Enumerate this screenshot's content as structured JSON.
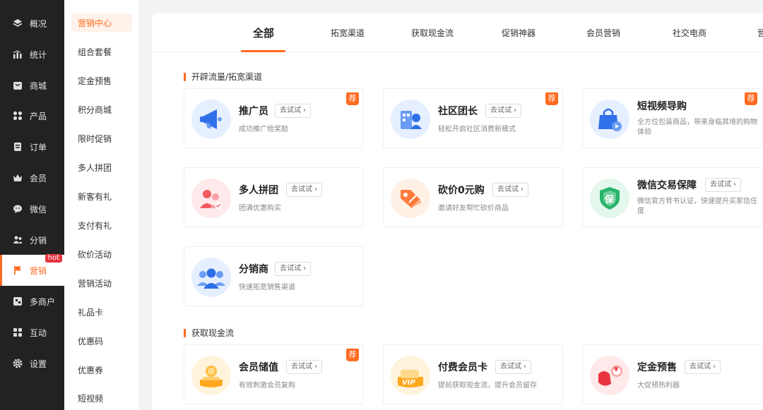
{
  "primary_nav": [
    {
      "label": "概况",
      "icon": "layers-icon"
    },
    {
      "label": "统计",
      "icon": "chart-icon"
    },
    {
      "label": "商城",
      "icon": "store-icon"
    },
    {
      "label": "产品",
      "icon": "grid-icon"
    },
    {
      "label": "订单",
      "icon": "order-icon"
    },
    {
      "label": "会员",
      "icon": "crown-icon"
    },
    {
      "label": "微信",
      "icon": "wechat-icon"
    },
    {
      "label": "分销",
      "icon": "users-icon"
    },
    {
      "label": "营销",
      "icon": "flag-icon",
      "badge": "hot"
    },
    {
      "label": "多商户",
      "icon": "merchant-icon"
    },
    {
      "label": "互动",
      "icon": "interact-icon"
    },
    {
      "label": "设置",
      "icon": "gear-icon"
    }
  ],
  "secondary_nav": [
    "营销中心",
    "组合套餐",
    "定金预售",
    "积分商城",
    "限时促销",
    "多人拼团",
    "新客有礼",
    "支付有礼",
    "砍价活动",
    "营销活动",
    "礼品卡",
    "优惠码",
    "优惠券",
    "短视频"
  ],
  "tabs": [
    "全部",
    "拓宽渠道",
    "获取现金流",
    "促销神器",
    "会员营销",
    "社交电商",
    "营"
  ],
  "try_label": "去试试",
  "badge_label": "荐",
  "sections": [
    {
      "title": "开辟流量/拓宽渠道"
    },
    {
      "title": "获取现金流"
    }
  ],
  "cards": [
    {
      "title": "推广员",
      "desc": "成功推广给奖励",
      "recommended": true,
      "icon": "megaphone-icon"
    },
    {
      "title": "社区团长",
      "desc": "轻松开启社区消费新模式",
      "recommended": true,
      "icon": "community-icon"
    },
    {
      "title": "短视频导购",
      "desc": "全方位包装商品，带来身临其境的购物体验",
      "recommended": true,
      "icon": "video-bag-icon"
    },
    {
      "title": "多人拼团",
      "desc": "团满优惠购买",
      "recommended": false,
      "icon": "group-icon"
    },
    {
      "title": "砍价0元购",
      "desc": "邀请好友帮忙砍价商品",
      "recommended": false,
      "icon": "price-tag-icon"
    },
    {
      "title": "微信交易保障",
      "desc": "微信官方背书认证，快速提升买家信任度",
      "recommended": false,
      "icon": "shield-icon",
      "shield_text": "保"
    },
    {
      "title": "分销商",
      "desc": "快速拓宽销售渠道",
      "recommended": false,
      "icon": "distributor-icon"
    },
    {
      "title": "会员储值",
      "desc": "有效刺激会员复购",
      "recommended": true,
      "icon": "coin-icon"
    },
    {
      "title": "付费会员卡",
      "desc": "提前获取现金流，提升会员留存",
      "recommended": false,
      "icon": "vip-card-icon",
      "card_text": "VIP"
    },
    {
      "title": "定金预售",
      "desc": "大促预热利器",
      "recommended": false,
      "icon": "presale-icon",
      "coin_text": "¥"
    }
  ]
}
